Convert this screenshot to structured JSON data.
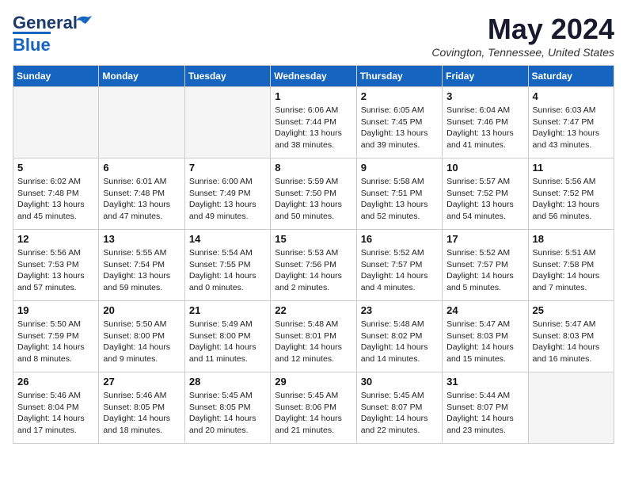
{
  "header": {
    "logo_line1": "General",
    "logo_line2": "Blue",
    "month_title": "May 2024",
    "location": "Covington, Tennessee, United States"
  },
  "weekdays": [
    "Sunday",
    "Monday",
    "Tuesday",
    "Wednesday",
    "Thursday",
    "Friday",
    "Saturday"
  ],
  "weeks": [
    [
      {
        "day": "",
        "info": ""
      },
      {
        "day": "",
        "info": ""
      },
      {
        "day": "",
        "info": ""
      },
      {
        "day": "1",
        "info": "Sunrise: 6:06 AM\nSunset: 7:44 PM\nDaylight: 13 hours\nand 38 minutes."
      },
      {
        "day": "2",
        "info": "Sunrise: 6:05 AM\nSunset: 7:45 PM\nDaylight: 13 hours\nand 39 minutes."
      },
      {
        "day": "3",
        "info": "Sunrise: 6:04 AM\nSunset: 7:46 PM\nDaylight: 13 hours\nand 41 minutes."
      },
      {
        "day": "4",
        "info": "Sunrise: 6:03 AM\nSunset: 7:47 PM\nDaylight: 13 hours\nand 43 minutes."
      }
    ],
    [
      {
        "day": "5",
        "info": "Sunrise: 6:02 AM\nSunset: 7:48 PM\nDaylight: 13 hours\nand 45 minutes."
      },
      {
        "day": "6",
        "info": "Sunrise: 6:01 AM\nSunset: 7:48 PM\nDaylight: 13 hours\nand 47 minutes."
      },
      {
        "day": "7",
        "info": "Sunrise: 6:00 AM\nSunset: 7:49 PM\nDaylight: 13 hours\nand 49 minutes."
      },
      {
        "day": "8",
        "info": "Sunrise: 5:59 AM\nSunset: 7:50 PM\nDaylight: 13 hours\nand 50 minutes."
      },
      {
        "day": "9",
        "info": "Sunrise: 5:58 AM\nSunset: 7:51 PM\nDaylight: 13 hours\nand 52 minutes."
      },
      {
        "day": "10",
        "info": "Sunrise: 5:57 AM\nSunset: 7:52 PM\nDaylight: 13 hours\nand 54 minutes."
      },
      {
        "day": "11",
        "info": "Sunrise: 5:56 AM\nSunset: 7:52 PM\nDaylight: 13 hours\nand 56 minutes."
      }
    ],
    [
      {
        "day": "12",
        "info": "Sunrise: 5:56 AM\nSunset: 7:53 PM\nDaylight: 13 hours\nand 57 minutes."
      },
      {
        "day": "13",
        "info": "Sunrise: 5:55 AM\nSunset: 7:54 PM\nDaylight: 13 hours\nand 59 minutes."
      },
      {
        "day": "14",
        "info": "Sunrise: 5:54 AM\nSunset: 7:55 PM\nDaylight: 14 hours\nand 0 minutes."
      },
      {
        "day": "15",
        "info": "Sunrise: 5:53 AM\nSunset: 7:56 PM\nDaylight: 14 hours\nand 2 minutes."
      },
      {
        "day": "16",
        "info": "Sunrise: 5:52 AM\nSunset: 7:57 PM\nDaylight: 14 hours\nand 4 minutes."
      },
      {
        "day": "17",
        "info": "Sunrise: 5:52 AM\nSunset: 7:57 PM\nDaylight: 14 hours\nand 5 minutes."
      },
      {
        "day": "18",
        "info": "Sunrise: 5:51 AM\nSunset: 7:58 PM\nDaylight: 14 hours\nand 7 minutes."
      }
    ],
    [
      {
        "day": "19",
        "info": "Sunrise: 5:50 AM\nSunset: 7:59 PM\nDaylight: 14 hours\nand 8 minutes."
      },
      {
        "day": "20",
        "info": "Sunrise: 5:50 AM\nSunset: 8:00 PM\nDaylight: 14 hours\nand 9 minutes."
      },
      {
        "day": "21",
        "info": "Sunrise: 5:49 AM\nSunset: 8:00 PM\nDaylight: 14 hours\nand 11 minutes."
      },
      {
        "day": "22",
        "info": "Sunrise: 5:48 AM\nSunset: 8:01 PM\nDaylight: 14 hours\nand 12 minutes."
      },
      {
        "day": "23",
        "info": "Sunrise: 5:48 AM\nSunset: 8:02 PM\nDaylight: 14 hours\nand 14 minutes."
      },
      {
        "day": "24",
        "info": "Sunrise: 5:47 AM\nSunset: 8:03 PM\nDaylight: 14 hours\nand 15 minutes."
      },
      {
        "day": "25",
        "info": "Sunrise: 5:47 AM\nSunset: 8:03 PM\nDaylight: 14 hours\nand 16 minutes."
      }
    ],
    [
      {
        "day": "26",
        "info": "Sunrise: 5:46 AM\nSunset: 8:04 PM\nDaylight: 14 hours\nand 17 minutes."
      },
      {
        "day": "27",
        "info": "Sunrise: 5:46 AM\nSunset: 8:05 PM\nDaylight: 14 hours\nand 18 minutes."
      },
      {
        "day": "28",
        "info": "Sunrise: 5:45 AM\nSunset: 8:05 PM\nDaylight: 14 hours\nand 20 minutes."
      },
      {
        "day": "29",
        "info": "Sunrise: 5:45 AM\nSunset: 8:06 PM\nDaylight: 14 hours\nand 21 minutes."
      },
      {
        "day": "30",
        "info": "Sunrise: 5:45 AM\nSunset: 8:07 PM\nDaylight: 14 hours\nand 22 minutes."
      },
      {
        "day": "31",
        "info": "Sunrise: 5:44 AM\nSunset: 8:07 PM\nDaylight: 14 hours\nand 23 minutes."
      },
      {
        "day": "",
        "info": ""
      }
    ]
  ]
}
